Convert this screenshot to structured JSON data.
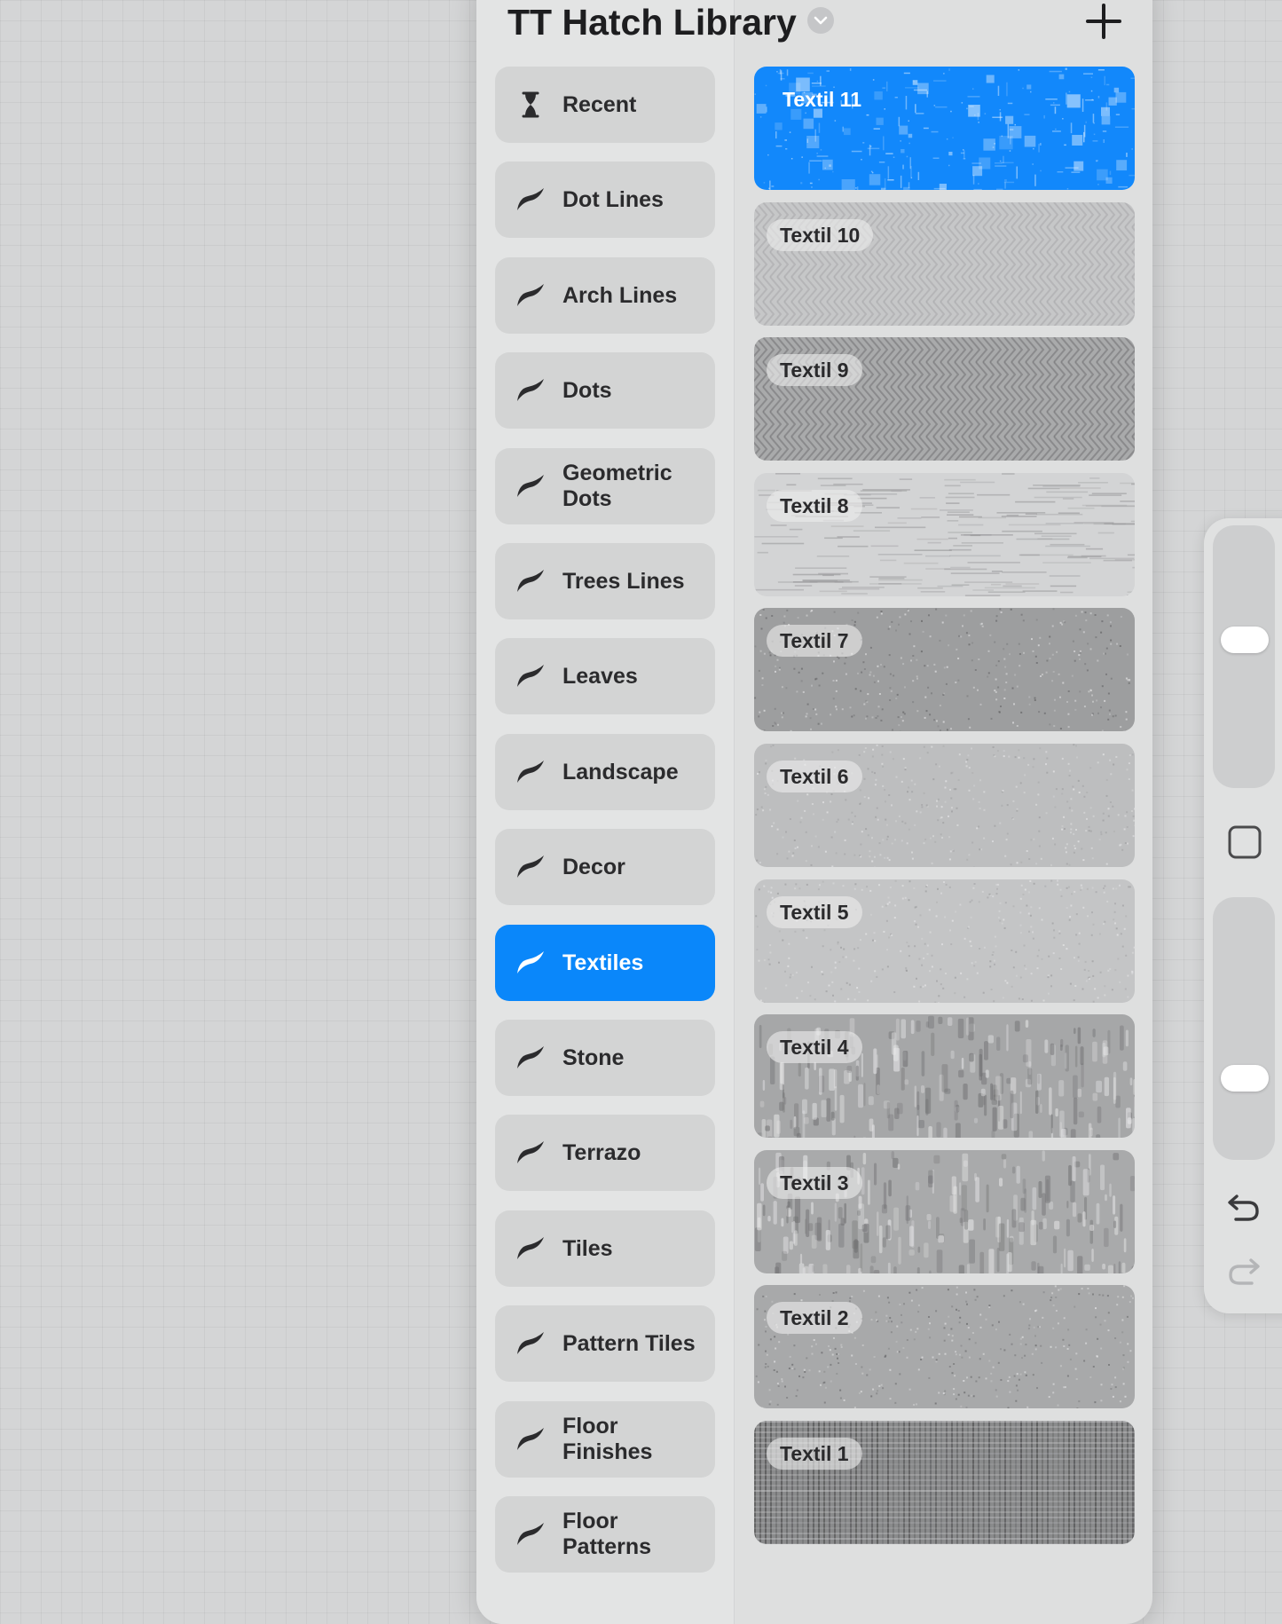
{
  "panel": {
    "title": "TT Hatch Library"
  },
  "categories": [
    {
      "label": "Recent",
      "icon": "hourglass-icon",
      "active": false
    },
    {
      "label": "Dot Lines",
      "icon": "brush-icon",
      "active": false
    },
    {
      "label": "Arch Lines",
      "icon": "brush-icon",
      "active": false
    },
    {
      "label": "Dots",
      "icon": "brush-icon",
      "active": false
    },
    {
      "label": "Geometric Dots",
      "icon": "brush-icon",
      "active": false
    },
    {
      "label": "Trees Lines",
      "icon": "brush-icon",
      "active": false
    },
    {
      "label": "Leaves",
      "icon": "brush-icon",
      "active": false
    },
    {
      "label": "Landscape",
      "icon": "brush-icon",
      "active": false
    },
    {
      "label": "Decor",
      "icon": "brush-icon",
      "active": false
    },
    {
      "label": "Textiles",
      "icon": "brush-icon",
      "active": true
    },
    {
      "label": "Stone",
      "icon": "brush-icon",
      "active": false
    },
    {
      "label": "Terrazo",
      "icon": "brush-icon",
      "active": false
    },
    {
      "label": "Tiles",
      "icon": "brush-icon",
      "active": false
    },
    {
      "label": "Pattern Tiles",
      "icon": "brush-icon",
      "active": false
    },
    {
      "label": "Floor Finishes",
      "icon": "brush-icon",
      "active": false
    },
    {
      "label": "Floor Patterns",
      "icon": "brush-icon",
      "active": false
    }
  ],
  "brushes": [
    {
      "label": "Textil 11",
      "active": true
    },
    {
      "label": "Textil 10",
      "active": false
    },
    {
      "label": "Textil 9",
      "active": false
    },
    {
      "label": "Textil 8",
      "active": false
    },
    {
      "label": "Textil 7",
      "active": false
    },
    {
      "label": "Textil 6",
      "active": false
    },
    {
      "label": "Textil 5",
      "active": false
    },
    {
      "label": "Textil 4",
      "active": false
    },
    {
      "label": "Textil 3",
      "active": false
    },
    {
      "label": "Textil 2",
      "active": false
    },
    {
      "label": "Textil 1",
      "active": false
    }
  ],
  "sliders": {
    "brush_size_level": 0.57,
    "opacity_level": 0.29
  },
  "colors": {
    "accent": "#0a87fa",
    "panel": "#dedfdf",
    "canvas": "#d4d5d6"
  }
}
